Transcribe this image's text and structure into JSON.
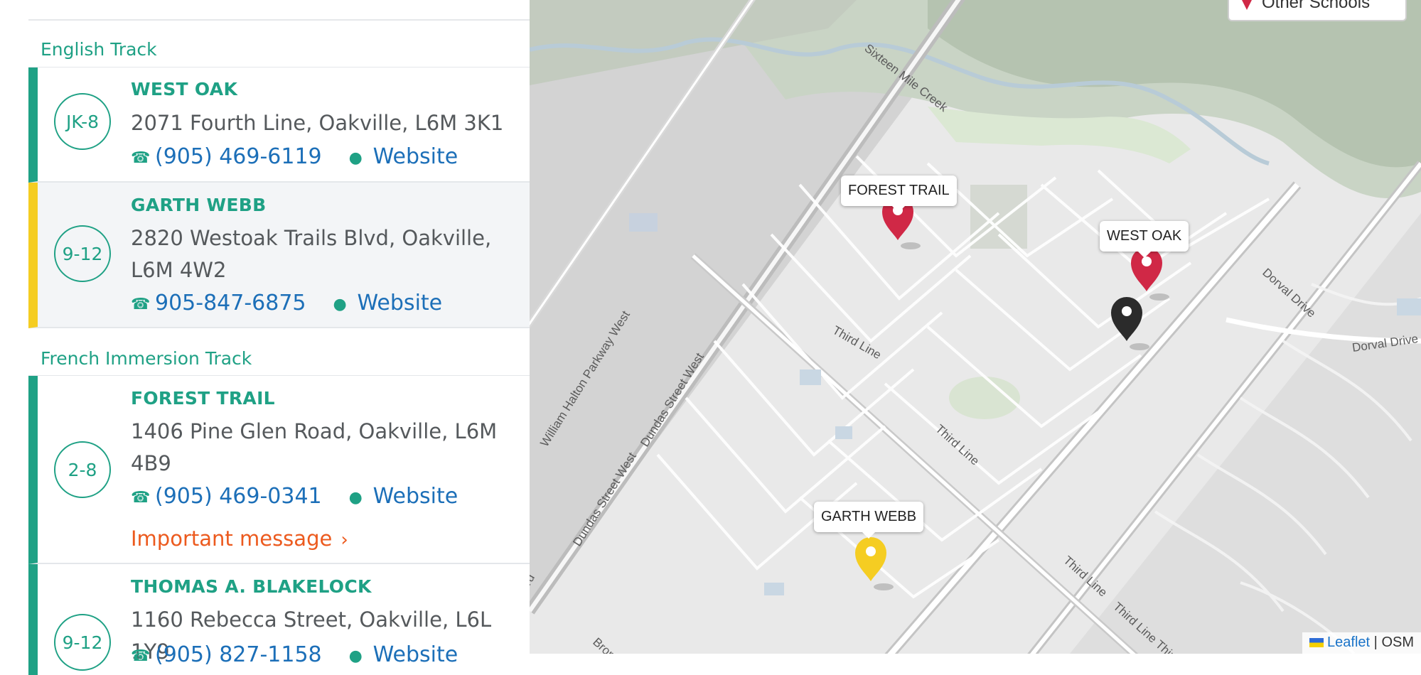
{
  "english_track": {
    "heading": "English Track",
    "schools": [
      {
        "grades": "JK-8",
        "name": "WEST OAK",
        "address": "2071 Fourth Line, Oakville, L6M 3K1",
        "phone": "(905) 469-6119",
        "website": "Website"
      },
      {
        "grades": "9-12",
        "name": "GARTH WEBB",
        "address": "2820 Westoak Trails Blvd, Oakville, L6M 4W2",
        "phone": "905-847-6875",
        "website": "Website"
      }
    ]
  },
  "french_track": {
    "heading": "French Immersion Track",
    "schools": [
      {
        "grades": "2-8",
        "name": "FOREST TRAIL",
        "address": "1406 Pine Glen Road, Oakville, L6M 4B9",
        "phone": "(905) 469-0341",
        "website": "Website",
        "message": "Important message"
      },
      {
        "grades": "9-12",
        "name": "THOMAS A. BLAKELOCK",
        "address": "1160 Rebecca Street, Oakville, L6L 1Y9",
        "phone": "(905) 827-1158",
        "website": "Website"
      }
    ]
  },
  "map": {
    "legend_label": "Other Schools",
    "markers": [
      {
        "label": "FOREST TRAIL",
        "color": "#d02846"
      },
      {
        "label": "WEST OAK",
        "color": "#d02846"
      },
      {
        "label": "",
        "color": "#2b2b2b"
      },
      {
        "label": "GARTH WEBB",
        "color": "#f5cd22"
      }
    ],
    "roads": [
      "Sixteen Mile Creek",
      "Third Line",
      "Third Line",
      "Third Line",
      "Third Line Third",
      "William Halton Parkway West",
      "Dundas Street West",
      "Dundas Street West",
      "Dorval Drive",
      "Dorval Drive",
      "Bront",
      "rd"
    ],
    "attribution_link": "Leaflet",
    "attribution_sep": "|",
    "attribution_osm": "OSM"
  },
  "colors": {
    "accent": "#1fa185",
    "link": "#1c6fb8",
    "warning": "#ec5a1e",
    "secondary_track": "#f5cd22"
  },
  "icons": {
    "phone": "phone-icon",
    "website": "globe-icon",
    "chevron": "chevron-right-icon",
    "pin": "map-pin-icon"
  }
}
